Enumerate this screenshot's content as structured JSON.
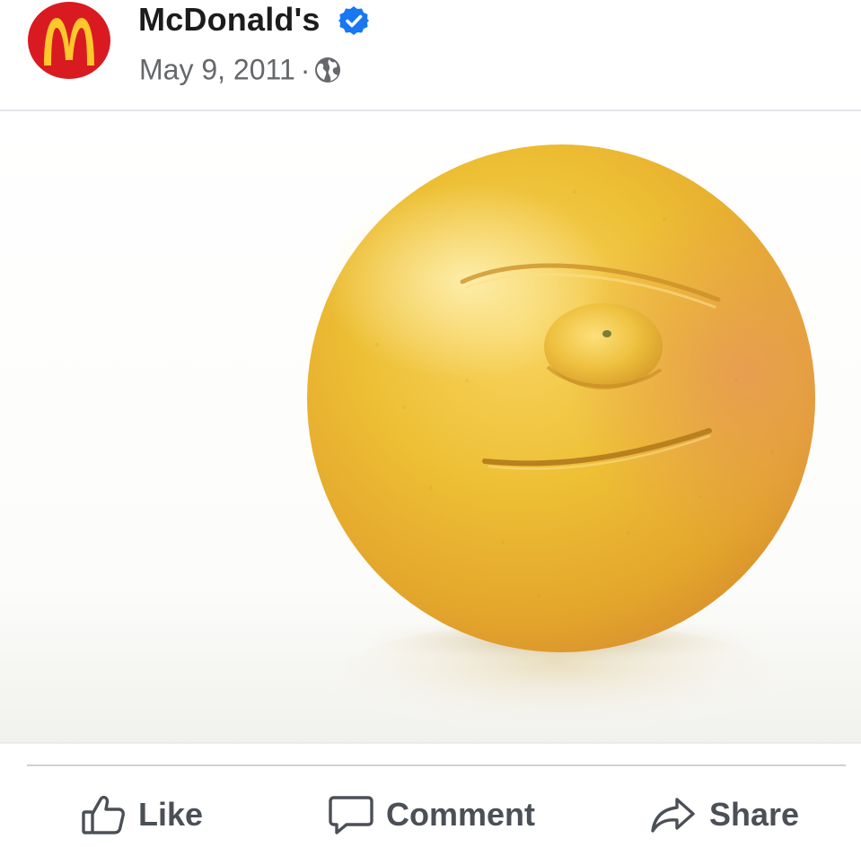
{
  "post": {
    "page_name": "McDonald's",
    "date": "May 9, 2011",
    "separator": "·",
    "audience_icon": "globe-icon",
    "verified_icon": "verified-badge-icon",
    "avatar_icon": "mcdonalds-golden-arches-logo",
    "image_subject": "lemon-face-photo"
  },
  "actions": {
    "like": {
      "label": "Like",
      "icon": "thumbs-up-icon"
    },
    "comment": {
      "label": "Comment",
      "icon": "speech-bubble-icon"
    },
    "share": {
      "label": "Share",
      "icon": "share-arrow-icon"
    }
  },
  "colors": {
    "logo_red": "#da1a21",
    "logo_gold": "#ffc72c",
    "verified_blue": "#1877f2",
    "secondary_text": "#65676b",
    "action_text": "#4b4f56",
    "divider": "#ced0d4"
  }
}
